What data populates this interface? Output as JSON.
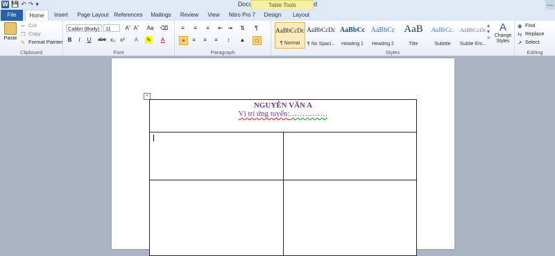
{
  "app": {
    "title": "Document1 - Microsoft Word",
    "context_tab_title": "Table Tools",
    "icon_letter": "W"
  },
  "qat": {
    "save_icon": "save-icon",
    "undo_icon": "undo-icon",
    "redo_icon": "redo-icon"
  },
  "tabs": [
    "File",
    "Home",
    "Insert",
    "Page Layout",
    "References",
    "Mailings",
    "Review",
    "View",
    "Nitro Pro 7",
    "Design",
    "Layout"
  ],
  "clipboard": {
    "paste": "Paste",
    "cut": "Cut",
    "copy": "Copy",
    "format_painter": "Format Painter",
    "label": "Clipboard"
  },
  "font": {
    "family": "Calibri (Body)",
    "size": "11",
    "label": "Font",
    "buttons": [
      "B",
      "I",
      "U",
      "abe",
      "x₂",
      "x²",
      "Aa"
    ]
  },
  "paragraph": {
    "label": "Paragraph",
    "pilcrow": "¶"
  },
  "styles": {
    "label": "Styles",
    "items": [
      {
        "sample": "AaBbCcDc",
        "name": "¶ Normal"
      },
      {
        "sample": "AaBbCcDc",
        "name": "¶ No Spaci..."
      },
      {
        "sample": "AaBbCc",
        "name": "Heading 1"
      },
      {
        "sample": "AaBbCc",
        "name": "Heading 2"
      },
      {
        "sample": "AaB",
        "name": "Title"
      },
      {
        "sample": "AaBbCc.",
        "name": "Subtitle"
      },
      {
        "sample": "AaBbCcDc",
        "name": "Subtle Em..."
      }
    ],
    "change_styles": "Change Styles"
  },
  "editing": {
    "find": "Find",
    "replace": "Replace",
    "select": "Select",
    "label": "Editing"
  },
  "document": {
    "name": "NGUYỄN VĂN A",
    "position_label": "Vị trí ứng tuyển:",
    "position_dots": "……………"
  },
  "colors": {
    "file_tab": "#2a5fac",
    "heading_text": "#7030a0",
    "context_tab": "#f6f0a8"
  }
}
